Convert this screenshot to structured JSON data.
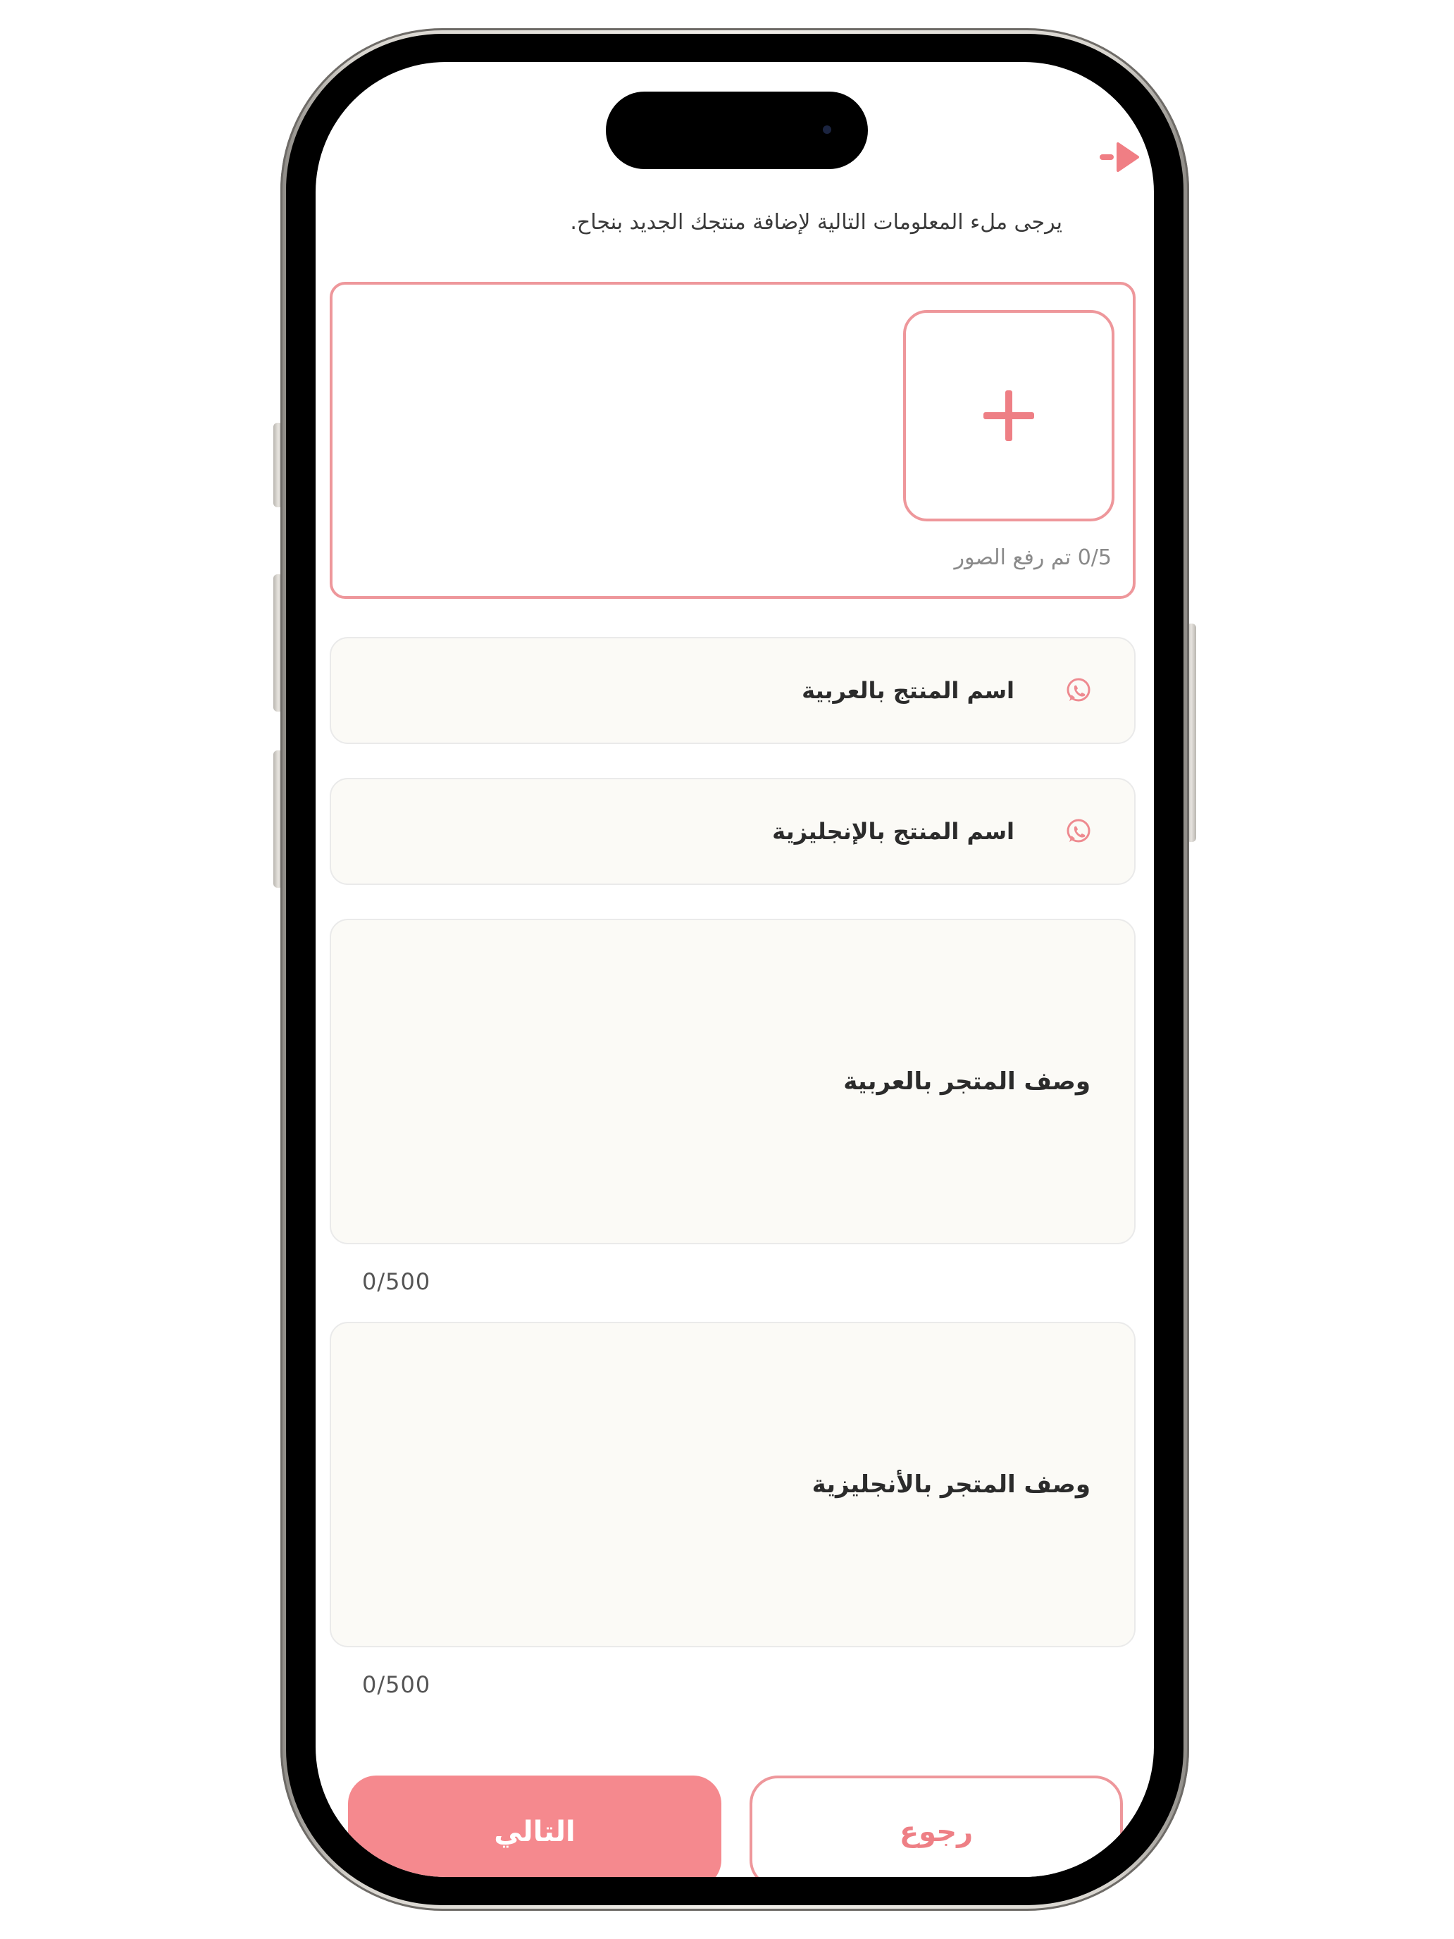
{
  "header": {
    "instruction": "يرجى ملء المعلومات التالية لإضافة منتجك الجديد بنجاح."
  },
  "upload": {
    "count_label": "0/5 تم رفع الصور"
  },
  "fields": {
    "name_ar": {
      "placeholder": "اسم المنتج بالعربية",
      "icon": "whatsapp-icon"
    },
    "name_en": {
      "placeholder": "اسم المنتج بالإنجليزية",
      "icon": "whatsapp-icon"
    },
    "desc_ar": {
      "placeholder": "وصف المتجر بالعربية",
      "counter": "0/500"
    },
    "desc_en": {
      "placeholder": "وصف المتجر بالأنجليزية",
      "counter": "0/500"
    }
  },
  "buttons": {
    "next_label": "التالي",
    "back_label": "رجوع"
  },
  "colors": {
    "accent": "#f5898e",
    "border_accent": "#ee979b",
    "field_bg": "#fbfaf6"
  }
}
